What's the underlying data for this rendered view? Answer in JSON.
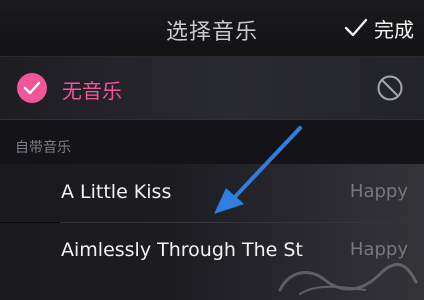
{
  "header": {
    "title": "选择音乐",
    "done_label": "完成",
    "done_icon": "checkmark-icon"
  },
  "no_music": {
    "label": "无音乐",
    "selected": true,
    "check_icon": "check-circle-icon",
    "status_icon": "no-symbol-icon",
    "accent_color": "#f0569a"
  },
  "section": {
    "label": "自带音乐"
  },
  "songs": [
    {
      "title": "A Little Kiss",
      "tag": "Happy"
    },
    {
      "title": "Aimlessly Through The St",
      "tag": "Happy"
    }
  ],
  "annotation": {
    "icon": "arrow-icon",
    "color": "#2f7fe0"
  },
  "watermark": {
    "icon": "watermark-logo-icon"
  }
}
